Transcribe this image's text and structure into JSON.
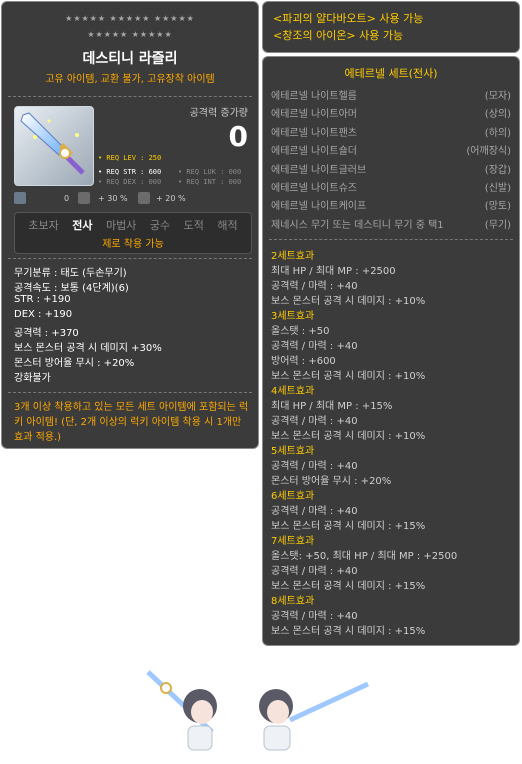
{
  "tooltip": {
    "stars_top": "★★★★★ ★★★★★ ★★★★★",
    "stars_bottom": "★★★★★ ★★★★★",
    "title": "데스티니 라즐리",
    "attributes": "고유 아이템, 교환 불가, 고유장착 아이템",
    "attack_increase_label": "공격력 증가량",
    "attack_increase_value": "0",
    "req": {
      "lev": "• REQ LEV : 250",
      "str": "• REQ STR : 600",
      "luk": "• REQ LUK : 000",
      "dex": "• REQ DEX : 000",
      "int": "• REQ INT : 000"
    },
    "stat_icons": {
      "a": "0",
      "b": "+ 30 %",
      "c": "+ 20 %"
    },
    "jobs": [
      "초보자",
      "전사",
      "마법사",
      "궁수",
      "도적",
      "해적"
    ],
    "active_job": "전사",
    "job_note": "제로 착용 가능",
    "stats": [
      "무기분류 : 태도 (두손무기)",
      "공격속도 : 보통 (4단계)(6)",
      "STR : +190",
      "DEX : +190",
      "공격력 : +370",
      "보스 몬스터 공격 시 데미지 +30%",
      "몬스터 방어율 무시 : +20%",
      "강화불가"
    ],
    "lucky_note": "3개 이상 착용하고 있는 모든 세트 아이템에 포함되는 럭키 아이템! (단, 2개 이상의 럭키 아이템 착용 시 1개만 효과 적용.)"
  },
  "usage": [
    "<파괴의 얄다바오트> 사용 가능",
    "<창조의 아이온> 사용 가능"
  ],
  "set": {
    "title": "에테르넬 세트(전사)",
    "items": [
      {
        "name": "에테르넬 나이트헬름",
        "part": "(모자)"
      },
      {
        "name": "에테르넬 나이트아머",
        "part": "(상의)"
      },
      {
        "name": "에테르넬 나이트팬츠",
        "part": "(하의)"
      },
      {
        "name": "에테르넬 나이트숄더",
        "part": "(어깨장식)"
      },
      {
        "name": "에테르넬 나이트글러브",
        "part": "(장갑)"
      },
      {
        "name": "에테르넬 나이트슈즈",
        "part": "(신발)"
      },
      {
        "name": "에테르넬 나이트케이프",
        "part": "(망토)"
      },
      {
        "name": "제네시스 무기 또는 데스티니 무기 중 택1",
        "part": "(무기)"
      }
    ],
    "effects": [
      {
        "header": "2세트효과",
        "lines": [
          "최대 HP / 최대 MP : +2500",
          "공격력 / 마력 : +40",
          "보스 몬스터 공격 시 데미지 : +10%"
        ]
      },
      {
        "header": "3세트효과",
        "lines": [
          "올스탯 : +50",
          "공격력 / 마력 : +40",
          "방어력 : +600",
          "보스 몬스터 공격 시 데미지 : +10%"
        ]
      },
      {
        "header": "4세트효과",
        "lines": [
          "최대 HP / 최대 MP : +15%",
          "공격력 / 마력 : +40",
          "보스 몬스터 공격 시 데미지 : +10%"
        ]
      },
      {
        "header": "5세트효과",
        "lines": [
          "공격력 / 마력 : +40",
          "몬스터 방어율 무시 : +20%"
        ]
      },
      {
        "header": "6세트효과",
        "lines": [
          "공격력 / 마력 : +40",
          "보스 몬스터 공격 시 데미지 : +15%"
        ]
      },
      {
        "header": "7세트효과",
        "lines": [
          "올스탯: +50, 최대 HP / 최대 MP : +2500",
          "공격력 / 마력 : +40",
          "보스 몬스터 공격 시 데미지 : +15%"
        ]
      },
      {
        "header": "8세트효과",
        "lines": [
          "공격력 / 마력 : +40",
          "보스 몬스터 공격 시 데미지 : +15%"
        ]
      }
    ]
  },
  "icons": {
    "weapon": "sword-icon",
    "character": "character-sprite"
  },
  "colors": {
    "panel": "#3b3b3b",
    "orange": "#ffaa00",
    "yellow": "#ffcc00",
    "gray_text": "#a6a6a6"
  }
}
